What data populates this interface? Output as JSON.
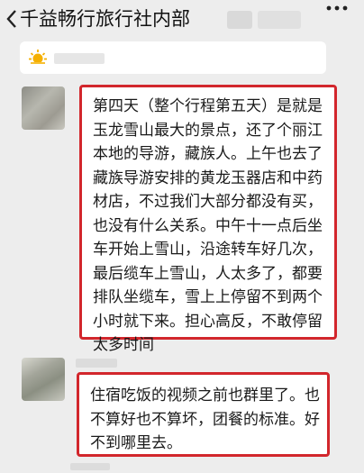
{
  "header": {
    "back_icon": "chevron-left-icon",
    "title": "千益畅行旅行社内部",
    "more_icon": "more-dots-icon"
  },
  "notice": {
    "icon": "sun-icon",
    "accent_color": "#f5b000"
  },
  "messages": [
    {
      "text": "第四天（整个行程第五天）是就是玉龙雪山最大的景点，还了个丽江本地的导游，藏族人。上午也去了藏族导游安排的黄龙玉器店和中药材店，不过我们大部分都没有买，也没有什么关系。中午十一点后坐车开始上雪山，沿途转车好几次，最后缆车上雪山，人太多了，都要排队坐缆车，雪上上停留不到两个小时就下来。担心高反，不敢停留太多时间"
    },
    {
      "text": "住宿吃饭的视频之前也群里了。也不算好也不算坏，团餐的标准。好不到哪里去。"
    }
  ],
  "colors": {
    "background": "#ededed",
    "bubble": "#ffffff",
    "highlight_border": "#d2262c"
  }
}
